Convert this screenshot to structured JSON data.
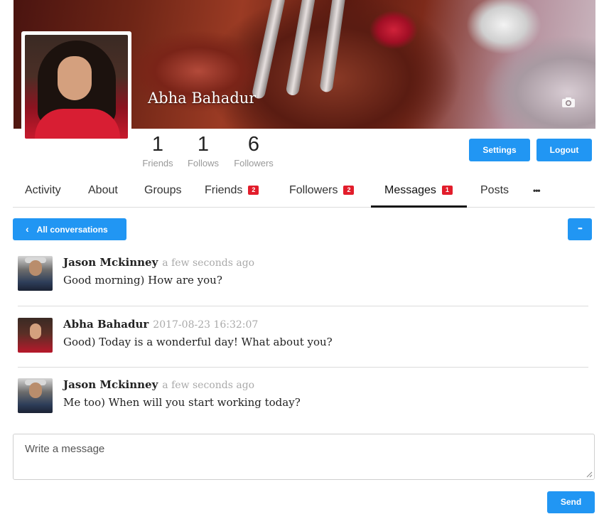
{
  "profile": {
    "name": "Abha Bahadur",
    "stats": [
      {
        "value": "1",
        "label": "Friends"
      },
      {
        "value": "1",
        "label": "Follows"
      },
      {
        "value": "6",
        "label": "Followers"
      }
    ]
  },
  "actions": {
    "settings_label": "Settings",
    "logout_label": "Logout"
  },
  "tabs": [
    {
      "label": "Activity"
    },
    {
      "label": "About"
    },
    {
      "label": "Groups"
    },
    {
      "label": "Friends",
      "badge": "2"
    },
    {
      "label": "Followers",
      "badge": "2"
    },
    {
      "label": "Messages",
      "badge": "1",
      "active": true
    },
    {
      "label": "Posts"
    },
    {
      "label": "•••"
    }
  ],
  "conversation": {
    "back_label": "All conversations",
    "back_chevron": "‹",
    "menu_glyph": "•••",
    "messages": [
      {
        "author": "Jason Mckinney",
        "time": "a few seconds ago",
        "text": "Good morning) How are you?"
      },
      {
        "author": "Abha Bahadur",
        "time": "2017-08-23 16:32:07",
        "text": "Good) Today is a wonderful day! What about you?"
      },
      {
        "author": "Jason Mckinney",
        "time": "a few seconds ago",
        "text": "Me too) When will you start working today?"
      }
    ]
  },
  "composer": {
    "placeholder": "Write a message",
    "send_label": "Send"
  },
  "colors": {
    "primary": "#2196f3",
    "badge": "#e21d2b"
  },
  "icons": {
    "camera": "camera-icon",
    "chevron": "chevron-left-icon",
    "more": "more-icon",
    "resize": "resize-handle-icon"
  }
}
